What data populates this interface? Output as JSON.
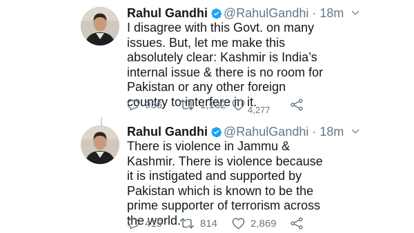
{
  "tweets": [
    {
      "author_name": "Rahul Gandhi",
      "handle": "@RahulGandhi",
      "separator": "·",
      "time": "18m",
      "text": "I disagree with this Govt. on many issues. But, let me make this absolutely clear: Kashmir is India’s internal issue & there is no room for Pakistan or any other foreign country to interfere in it.",
      "reply_count": "936",
      "retweet_count": "1,132",
      "like_count": "4,277"
    },
    {
      "author_name": "Rahul Gandhi",
      "handle": "@RahulGandhi",
      "separator": "·",
      "time": "18m",
      "text": "There is violence in Jammu & Kashmir. There is violence because it is instigated and supported by Pakistan which is known to be the prime supporter of terrorism across the world.",
      "reply_count": "415",
      "retweet_count": "814",
      "like_count": "2,869"
    }
  ],
  "icons": {
    "verified": "verified-badge-icon",
    "menu": "chevron-down-icon",
    "reply": "reply-icon",
    "retweet": "retweet-icon",
    "like": "heart-icon",
    "share": "share-icon"
  },
  "colors": {
    "verified_blue": "#1da1f2",
    "text": "#14171a",
    "muted": "#657786"
  }
}
